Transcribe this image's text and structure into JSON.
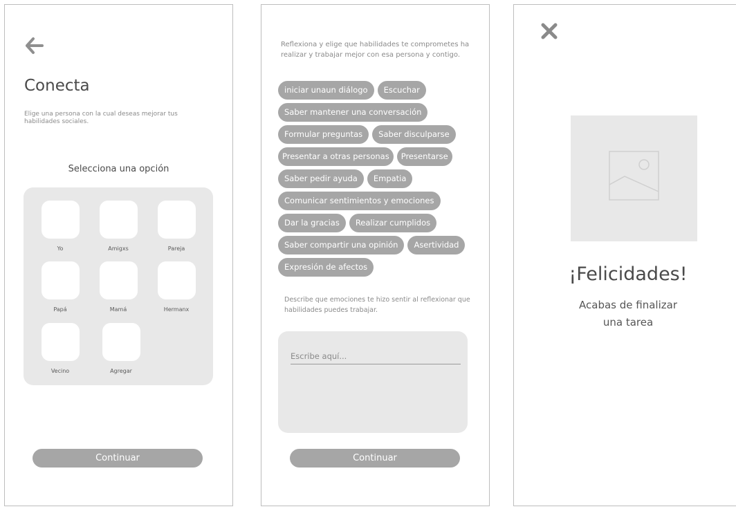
{
  "screen1": {
    "title": "Conecta",
    "description": "Elige una persona con la cual deseas mejorar tus habilidades sociales.",
    "select_label": "Selecciona una opción",
    "options": [
      "Yo",
      "Amigxs",
      "Pareja",
      "Papá",
      "Mamá",
      "Hermanx",
      "Vecino",
      "Agregar"
    ],
    "continue_label": "Continuar",
    "back_icon": "arrow-left-icon"
  },
  "screen2": {
    "description": "Reflexiona y elige que habilidades te comprometes ha realizar y trabajar mejor con esa persona y contigo.",
    "skills": [
      "iniciar unaun diálogo",
      "Escuchar",
      "Saber mantener una conversación",
      "Formular preguntas",
      "Saber disculparse",
      "Presentar a otras personas",
      "Presentarse",
      "Saber pedir ayuda",
      "Empatia",
      "Comunicar sentimientos y emociones",
      "Dar la gracias",
      "Realizar cumplidos",
      "Saber compartir una opinión",
      "Asertividad",
      "Expresión de afectos"
    ],
    "emotion_prompt": "Describe que emociones te hizo sentir al reflexionar que habilidades puedes trabajar.",
    "input_placeholder": "Escribe aquí...",
    "input_value": "",
    "continue_label": "Continuar"
  },
  "screen3": {
    "close_icon": "close-icon",
    "image_icon": "image-placeholder-icon",
    "heading": "¡Felicidades!",
    "message_line1": "Acabas de finalizar",
    "message_line2": "una tarea"
  },
  "colors": {
    "button": "#a6a6a6",
    "panel": "#e8e8e8",
    "text_dark": "#4a4a4a",
    "text_muted": "#8a8a8a"
  }
}
